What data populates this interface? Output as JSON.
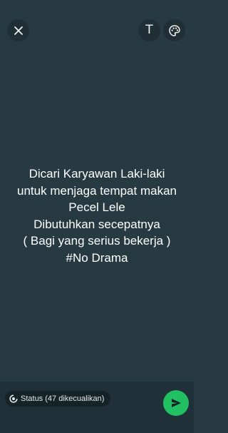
{
  "header": {
    "close_icon": "close-icon",
    "text_tool_label": "T",
    "palette_icon": "palette-icon"
  },
  "message": {
    "lines": [
      "Dicari Karyawan Laki-laki",
      "untuk menjaga tempat makan",
      "Pecel Lele",
      "Dibutuhkan secepatnya",
      "( Bagi yang serius bekerja )",
      "#No Drama"
    ]
  },
  "footer": {
    "audience_label": "Status (47 dikecualikan)",
    "audience_icon": "status-ring-icon",
    "send_icon": "send-icon"
  },
  "colors": {
    "background": "#273a42",
    "bottom_bar": "#1f3038",
    "send_button": "#21c063",
    "text": "#ffffff"
  }
}
